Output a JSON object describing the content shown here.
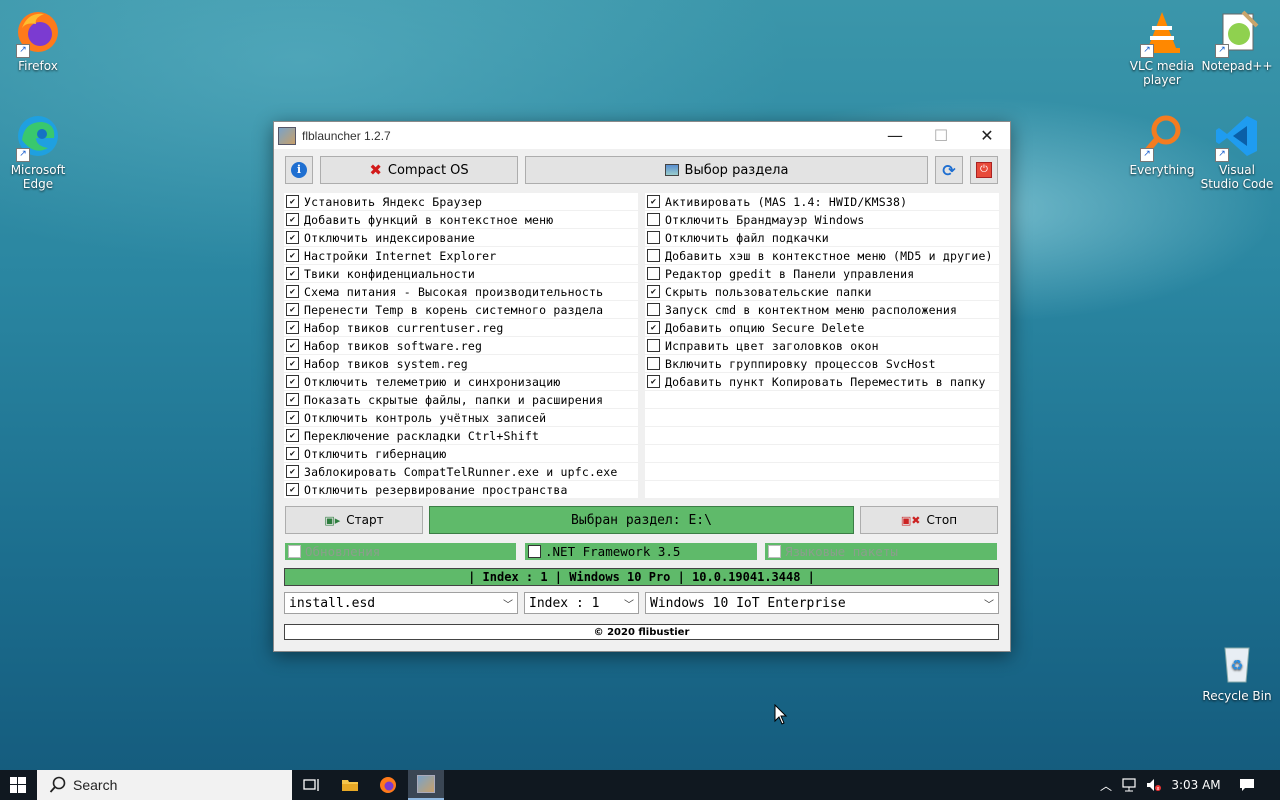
{
  "desktop": {
    "icons": {
      "firefox": "Firefox",
      "edge": "Microsoft Edge",
      "vlc": "VLC media player",
      "notepadpp": "Notepad++",
      "everything": "Everything",
      "vscode": "Visual Studio Code",
      "recycle": "Recycle Bin"
    }
  },
  "window": {
    "title": "flblauncher 1.2.7",
    "toolbar": {
      "compact_os": "Compact OS",
      "select_partition": "Выбор раздела"
    },
    "left_options": [
      {
        "label": "Установить Яндекс Браузер",
        "checked": true
      },
      {
        "label": "Добавить функций в контекстное меню",
        "checked": true
      },
      {
        "label": "Отключить индексирование",
        "checked": true
      },
      {
        "label": "Настройки Internet Explorer",
        "checked": true
      },
      {
        "label": "Твики конфиденциальности",
        "checked": true
      },
      {
        "label": "Схема питания - Высокая производительность",
        "checked": true
      },
      {
        "label": "Перенести Temp в корень системного раздела",
        "checked": true
      },
      {
        "label": "Набор твиков currentuser.reg",
        "checked": true
      },
      {
        "label": "Набор твиков software.reg",
        "checked": true
      },
      {
        "label": "Набор твиков system.reg",
        "checked": true
      },
      {
        "label": "Отключить телеметрию и синхронизацию",
        "checked": true
      },
      {
        "label": "Показать скрытые файлы, папки и расширения",
        "checked": true
      },
      {
        "label": "Отключить контроль учётных записей",
        "checked": true
      },
      {
        "label": "Переключение раскладки Ctrl+Shift",
        "checked": true
      },
      {
        "label": "Отключить гибернацию",
        "checked": true
      },
      {
        "label": "Заблокировать CompatTelRunner.exe и upfc.exe",
        "checked": true
      },
      {
        "label": "Отключить резервирование пространства",
        "checked": true
      }
    ],
    "right_options": [
      {
        "label": "Активировать (MAS 1.4: HWID/KMS38)",
        "checked": true
      },
      {
        "label": "Отключить Брандмауэр Windows",
        "checked": false
      },
      {
        "label": "Отключить файл подкачки",
        "checked": false
      },
      {
        "label": "Добавить хэш в контекстное меню (MD5 и другие)",
        "checked": false
      },
      {
        "label": "Редактор gpedit в Панели управления",
        "checked": false
      },
      {
        "label": "Скрыть пользовательские папки",
        "checked": true
      },
      {
        "label": "Запуск cmd в контектном меню расположения",
        "checked": false
      },
      {
        "label": "Добавить опцию Secure Delete",
        "checked": true
      },
      {
        "label": "Исправить цвет заголовков окон",
        "checked": false
      },
      {
        "label": "Включить группировку процессов SvcHost",
        "checked": false
      },
      {
        "label": "Добавить пункт Копировать Переместить в папку",
        "checked": true
      }
    ],
    "start_label": "Старт",
    "selected_partition": "Выбран раздел: E:\\",
    "stop_label": "Стоп",
    "updates_label": "Обновления",
    "netfx_label": ".NET Framework 3.5",
    "lang_packs_label": "Языковые пакеты",
    "status": "| Index : 1 | Windows 10 Pro | 10.0.19041.3448 |",
    "combo_file": "install.esd",
    "combo_index": "Index : 1",
    "combo_edition": "Windows 10 IoT Enterprise",
    "footer": "© 2020 flibustier"
  },
  "taskbar": {
    "search_placeholder": "Search",
    "time": "3:03 AM"
  },
  "colors": {
    "accent_green": "#5fba6a",
    "taskbar": "#101820"
  }
}
